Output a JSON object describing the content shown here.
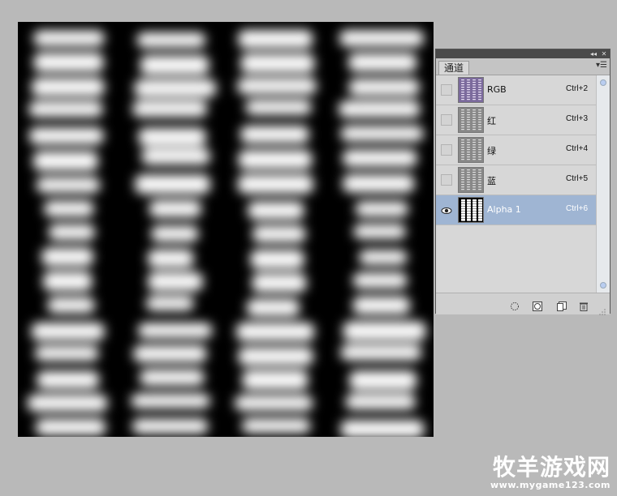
{
  "panel": {
    "tab_label": "通道",
    "collapse_label": "◂◂",
    "close_label": "✕",
    "menu_label": "▾☰",
    "channels": [
      {
        "name": "RGB",
        "shortcut": "Ctrl+2",
        "visible": false,
        "selected": false,
        "thumb": "rgb"
      },
      {
        "name": "红",
        "shortcut": "Ctrl+3",
        "visible": false,
        "selected": false,
        "thumb": "gray"
      },
      {
        "name": "绿",
        "shortcut": "Ctrl+4",
        "visible": false,
        "selected": false,
        "thumb": "gray"
      },
      {
        "name": "蓝",
        "shortcut": "Ctrl+5",
        "visible": false,
        "selected": false,
        "thumb": "gray"
      },
      {
        "name": "Alpha 1",
        "shortcut": "Ctrl+6",
        "visible": true,
        "selected": true,
        "thumb": "alpha"
      }
    ],
    "footer_icons": [
      "load-selection-icon",
      "save-selection-icon",
      "new-channel-icon",
      "delete-channel-icon"
    ]
  },
  "watermark": {
    "chinese": "牧羊游戏网",
    "url": "www.mygame123.com"
  },
  "colors": {
    "selected_row": "#9fb5d3",
    "background": "#b9b9b9"
  }
}
